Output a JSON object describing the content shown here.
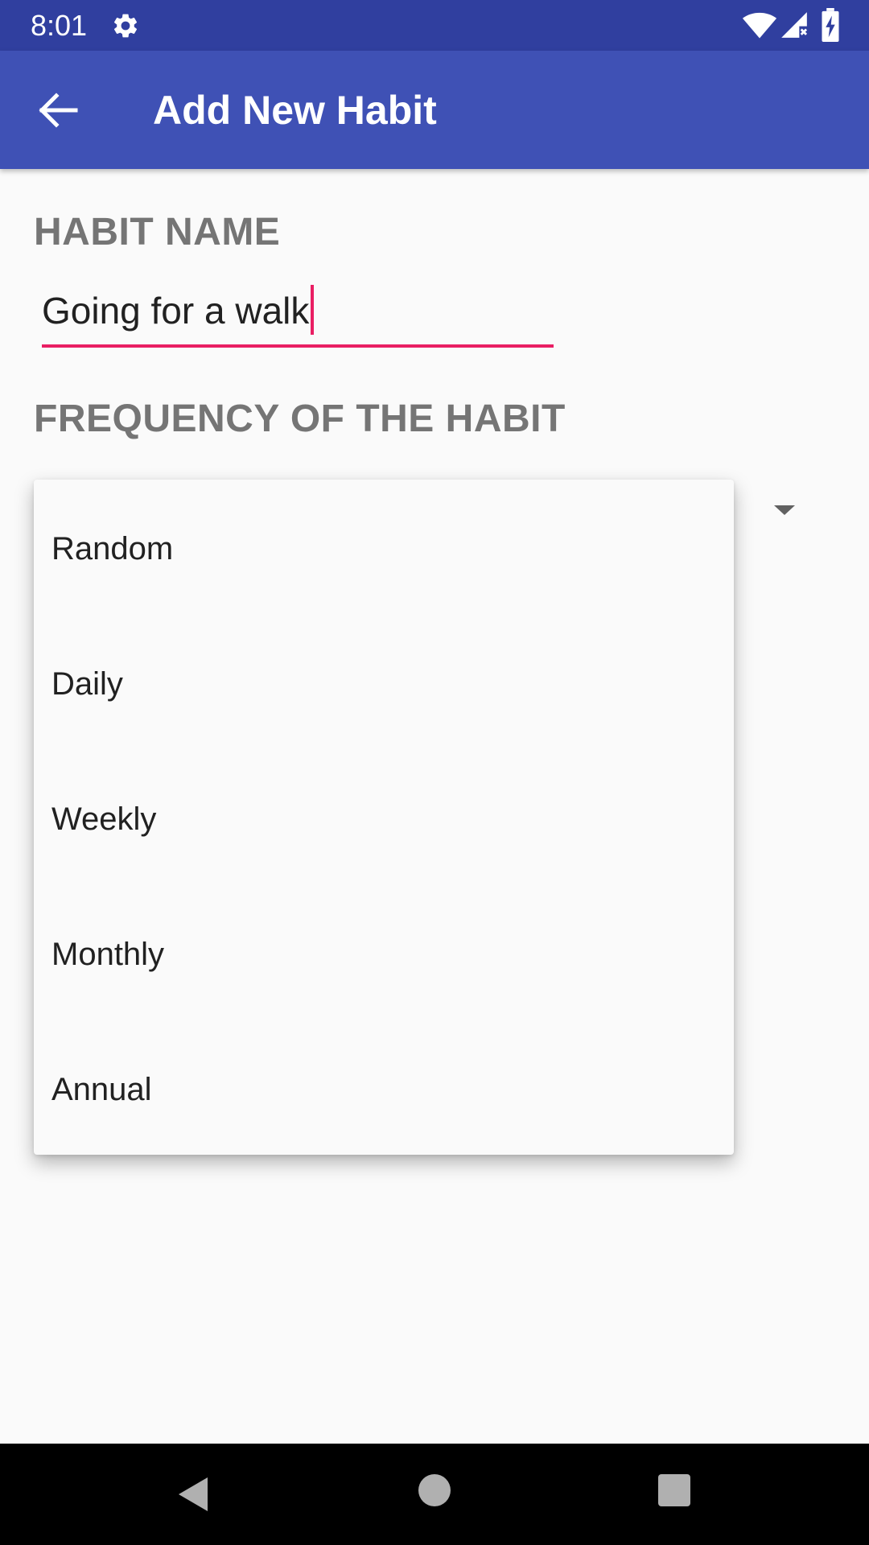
{
  "status_bar": {
    "time": "8:01",
    "icons": [
      "gear-icon",
      "wifi-icon",
      "cell-signal-icon",
      "battery-charging-icon"
    ]
  },
  "app_bar": {
    "title": "Add New Habit",
    "back_icon": "arrow-left-icon"
  },
  "form": {
    "habit_name_label": "HABIT NAME",
    "habit_name_value": "Going for a walk",
    "frequency_label": "FREQUENCY OF THE HABIT"
  },
  "frequency_options": [
    "Random",
    "Daily",
    "Weekly",
    "Monthly",
    "Annual"
  ],
  "nav_bar": {
    "icons": [
      "nav-back-icon",
      "nav-home-icon",
      "nav-recents-icon"
    ]
  },
  "colors": {
    "status_bar": "#303f9f",
    "app_bar": "#3f51b5",
    "accent": "#e91e63",
    "label_gray": "#757575",
    "background": "#fafafa"
  }
}
